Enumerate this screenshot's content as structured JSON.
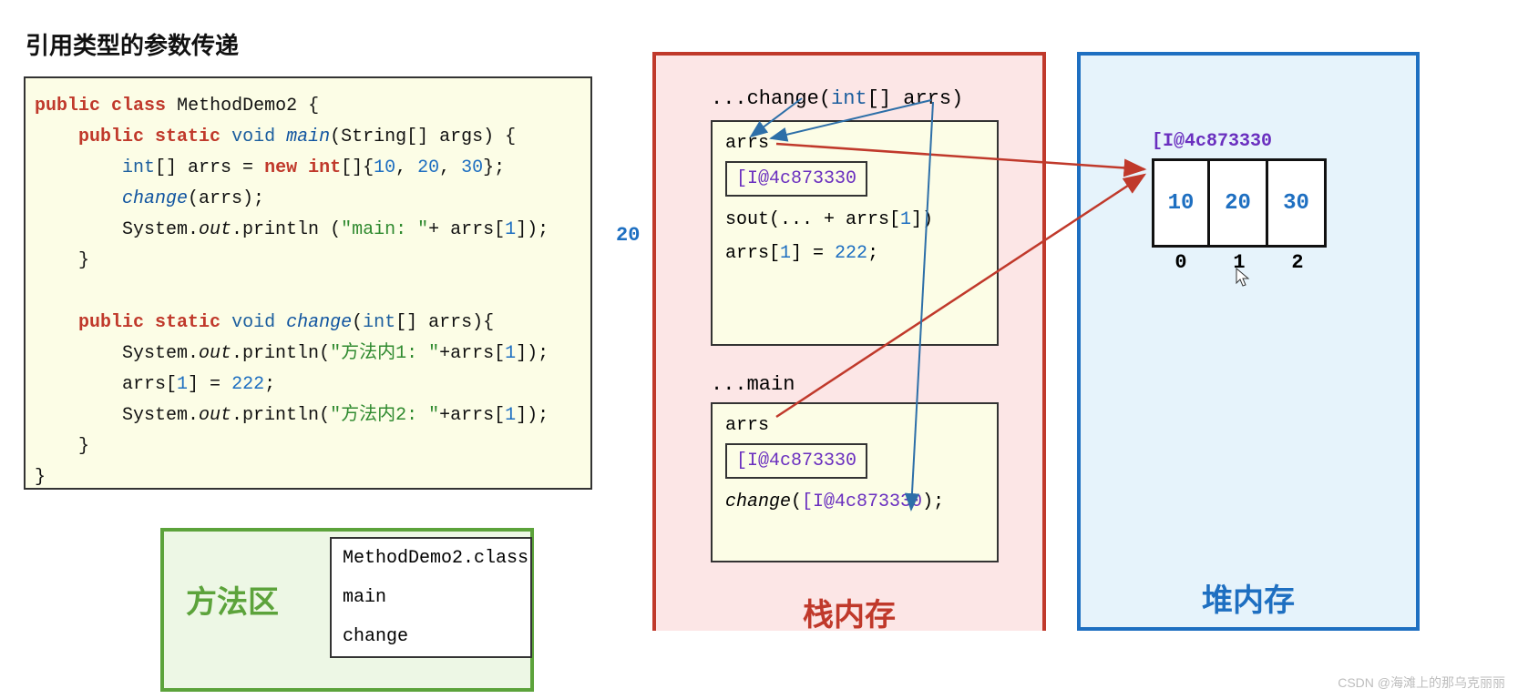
{
  "title": "引用类型的参数传递",
  "code_lines": {
    "l1a": "public",
    "l1b": "class",
    "l1c": "MethodDemo2 {",
    "l2a": "public static",
    "l2b": "void",
    "l2c": "main",
    "l2d": "(String[] args) {",
    "l3a": "int",
    "l3b": "[] arrs = ",
    "l3c": "new int",
    "l3d": "[]{",
    "l3e": "10",
    "l3f": ", ",
    "l3g": "20",
    "l3h": ", ",
    "l3i": "30",
    "l3j": "};",
    "l4a": "change",
    "l4b": "(arrs);",
    "l5a": "System.",
    "l5b": "out",
    "l5c": ".println (",
    "l5d": "\"main: \"",
    "l5e": "+ arrs[",
    "l5f": "1",
    "l5g": "]);",
    "l6": "}",
    "l7a": "public static",
    "l7b": "void",
    "l7c": "change",
    "l7d": "(",
    "l7e": "int",
    "l7f": "[] arrs){",
    "l8a": "System.",
    "l8b": "out",
    "l8c": ".println(",
    "l8d": "\"方法内1: \"",
    "l8e": "+arrs[",
    "l8f": "1",
    "l8g": "]);",
    "l9a": "arrs[",
    "l9b": "1",
    "l9c": "] = ",
    "l9d": "222",
    "l9e": ";",
    "l10a": "System.",
    "l10b": "out",
    "l10c": ".println(",
    "l10d": "\"方法内2: \"",
    "l10e": "+arrs[",
    "l10f": "1",
    "l10g": "]);",
    "l11": "}",
    "l12": "}"
  },
  "out20": "20",
  "method_area": {
    "label": "方法区",
    "class": "MethodDemo2.class",
    "m1": "main",
    "m2": "change"
  },
  "stack": {
    "label": "栈内存",
    "change_hdr_a": "...change(",
    "change_hdr_b": "int",
    "change_hdr_c": "[] arrs)",
    "main_hdr": "...main",
    "arrs": "arrs",
    "hash": "[I@4c873330",
    "sout_a": "sout(... + arrs[",
    "sout_b": "1",
    "sout_c": "])",
    "assign_a": "arrs[",
    "assign_b": "1",
    "assign_c": "] = ",
    "assign_d": "222",
    "assign_e": ";",
    "call_a": "change",
    "call_b": "(",
    "call_c": "[I@4c873330",
    "call_d": ");"
  },
  "heap": {
    "label": "堆内存",
    "hash": "[I@4c873330",
    "v0": "10",
    "v1": "20",
    "v2": "30",
    "i0": "0",
    "i1": "1",
    "i2": "2"
  },
  "watermark": "CSDN @海滩上的那乌克丽丽"
}
